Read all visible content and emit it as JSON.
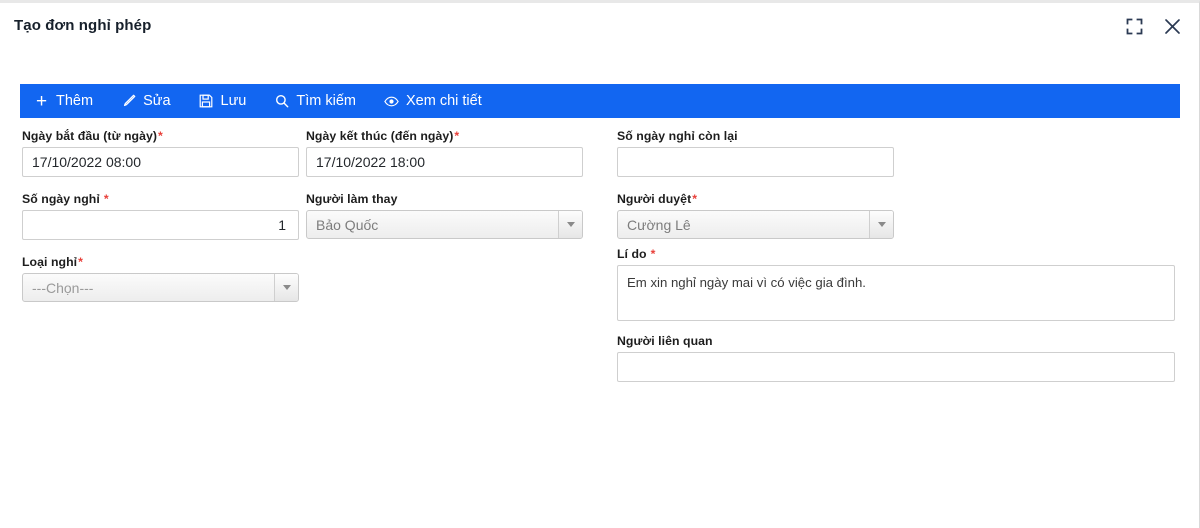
{
  "window": {
    "title": "Tạo đơn nghỉ phép",
    "accent_color": "#1266f1",
    "required_color": "#e8403a",
    "header_icons": [
      {
        "name": "fullscreen-icon",
        "label": "Toàn màn hình"
      },
      {
        "name": "close-icon",
        "label": "Đóng"
      }
    ]
  },
  "toolbar": {
    "items": [
      {
        "icon": "plus-icon",
        "label": "Thêm"
      },
      {
        "icon": "pencil-icon",
        "label": "Sửa"
      },
      {
        "icon": "save-icon",
        "label": "Lưu"
      },
      {
        "icon": "search-icon",
        "label": "Tìm kiếm"
      },
      {
        "icon": "eye-icon",
        "label": "Xem chi tiết"
      }
    ]
  },
  "form": {
    "start_date": {
      "label": "Ngày bắt đầu (từ ngày)",
      "required": true,
      "value": "17/10/2022 08:00",
      "placeholder": ""
    },
    "end_date": {
      "label": "Ngày kết thúc (đến ngày)",
      "required": true,
      "value": "17/10/2022 18:00",
      "placeholder": ""
    },
    "remaining_days": {
      "label": "Số ngày nghỉ còn lại",
      "required": false,
      "value": "",
      "placeholder": ""
    },
    "leave_days": {
      "label": "Số ngày nghỉ",
      "required": true,
      "value": "1",
      "placeholder": ""
    },
    "substitute": {
      "label": "Người làm thay",
      "required": false,
      "value": "Bảo Quốc",
      "disabled": true
    },
    "approver": {
      "label": "Người duyệt",
      "required": true,
      "value": "Cường Lê",
      "disabled": true
    },
    "leave_type": {
      "label": "Loại nghỉ",
      "required": true,
      "value": "---Chọn---",
      "disabled": false
    },
    "reason": {
      "label": "Lí do",
      "required": true,
      "value": "Em xin nghỉ ngày mai vì có việc gia đình.",
      "placeholder": ""
    },
    "related_people": {
      "label": "Người liên quan",
      "required": false,
      "value": "",
      "placeholder": ""
    }
  }
}
